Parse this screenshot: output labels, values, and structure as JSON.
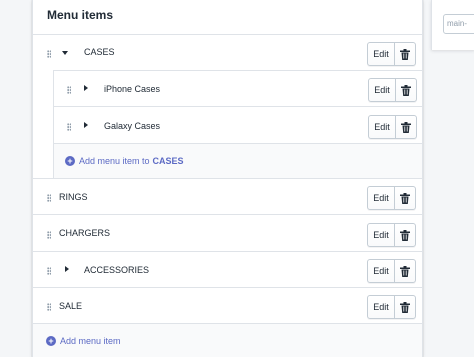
{
  "card": {
    "title": "Menu items"
  },
  "items": [
    {
      "label": "CASES",
      "expanded": true
    },
    {
      "label": "iPhone Cases",
      "expanded": false
    },
    {
      "label": "Galaxy Cases",
      "expanded": false
    },
    {
      "label": "RINGS"
    },
    {
      "label": "CHARGERS"
    },
    {
      "label": "ACCESSORIES",
      "expanded": false
    },
    {
      "label": "SALE"
    }
  ],
  "actions": {
    "edit_label": "Edit",
    "delete_icon": "trash-icon"
  },
  "add_child": {
    "prefix": "Add menu item to",
    "target": "CASES"
  },
  "add_root": {
    "label": "Add menu item"
  },
  "side_panel": {
    "handle_value": "main-"
  },
  "colors": {
    "link": "#5c6ac4",
    "border": "#dfe3e8",
    "text": "#212b36"
  }
}
